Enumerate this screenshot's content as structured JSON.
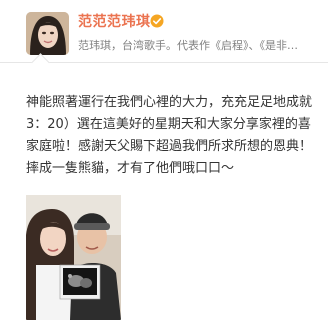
{
  "profile": {
    "name": "范范范玮琪",
    "description": "范玮琪，台湾歌手。代表作《启程》、《是非…",
    "verified_icon": "verified-badge-icon",
    "accent_color": "#eb7350"
  },
  "post": {
    "lines": [
      "神能照著運行在我們心裡的大力，充充足足地成就",
      "3：20）選在這美好的星期天和大家分享家裡的喜",
      "家庭啦！感謝天父賜下超過我們所求所想的恩典！",
      "摔成一隻熊貓，才有了他們哦口口～"
    ]
  },
  "photo": {
    "icon": "couple-ultrasound-photo"
  }
}
